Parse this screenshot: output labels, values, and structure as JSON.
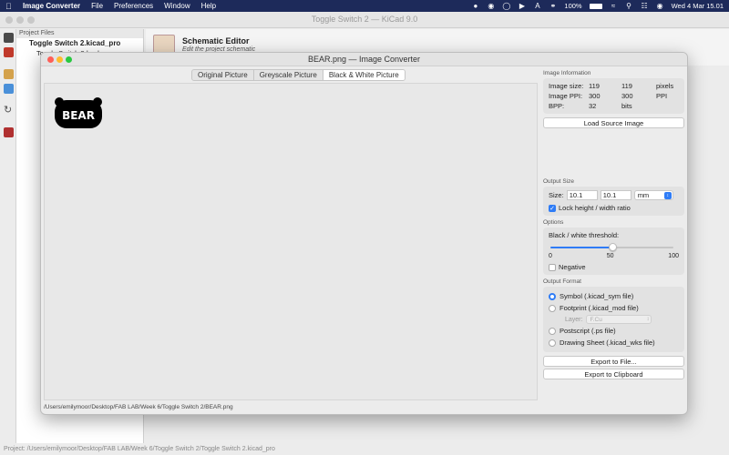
{
  "menubar": {
    "app_name": "Image Converter",
    "menus": [
      "File",
      "Preferences",
      "Window",
      "Help"
    ],
    "battery": "100%",
    "datetime": "Wed 4 Mar  15.01"
  },
  "kicad": {
    "window_title": "Toggle Switch 2 — KiCad 9.0",
    "project_files_header": "Project Files",
    "tree": {
      "root": "Toggle Switch 2.kicad_pro",
      "child": "Toggle Switch 2-backups"
    },
    "launcher": {
      "title": "Schematic Editor",
      "subtitle": "Edit the project schematic"
    },
    "status": "Project: /Users/emilymoor/Desktop/FAB LAB/Week 6/Toggle Switch 2/Toggle Switch 2.kicad_pro"
  },
  "converter": {
    "window_title": "BEAR.png — Image Converter",
    "tabs": [
      "Original Picture",
      "Greyscale Picture",
      "Black & White Picture"
    ],
    "active_tab": 2,
    "bear_text": "BEAR",
    "file_path": "/Users/emilymoor/Desktop/FAB LAB/Week 6/Toggle Switch 2/BEAR.png",
    "image_information": {
      "title": "Image Information",
      "rows": [
        {
          "label": "Image size:",
          "a": "119",
          "b": "119",
          "unit": "pixels"
        },
        {
          "label": "Image PPI:",
          "a": "300",
          "b": "300",
          "unit": "PPI"
        },
        {
          "label": "BPP:",
          "a": "32",
          "b": "bits",
          "unit": ""
        }
      ]
    },
    "load_button": "Load Source Image",
    "output_size": {
      "title": "Output Size",
      "size_label": "Size:",
      "width": "10.1",
      "height": "10.1",
      "unit": "mm",
      "lock_label": "Lock height / width ratio",
      "lock_checked": true
    },
    "options": {
      "title": "Options",
      "threshold_label": "Black / white threshold:",
      "threshold_value": 50,
      "threshold_min": "0",
      "threshold_mid": "50",
      "threshold_max": "100",
      "negative_label": "Negative",
      "negative_checked": false
    },
    "output_format": {
      "title": "Output Format",
      "symbol": "Symbol (.kicad_sym file)",
      "footprint": "Footprint (.kicad_mod file)",
      "layer_label": "Layer:",
      "layer_value": "F.Cu",
      "postscript": "Postscript (.ps file)",
      "drawing_sheet": "Drawing Sheet (.kicad_wks file)",
      "selected": "symbol"
    },
    "export_file_button": "Export to File...",
    "export_clipboard_button": "Export to Clipboard"
  },
  "colors": {
    "menubar_bg": "#1d2a5a",
    "accent": "#2f7cf6"
  }
}
